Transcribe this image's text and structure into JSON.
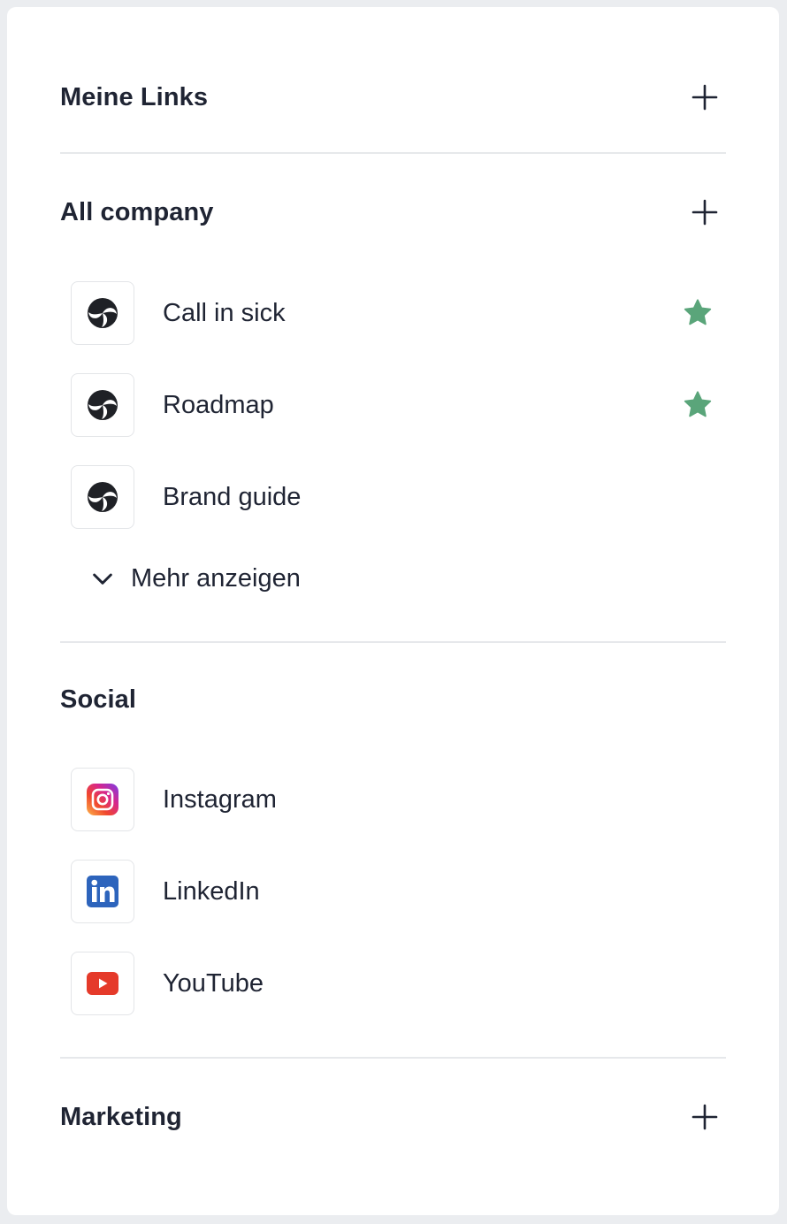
{
  "sections": {
    "my_links": {
      "title": "Meine Links",
      "add_icon": "plus-icon"
    },
    "all_company": {
      "title": "All company",
      "add_icon": "plus-icon",
      "items": [
        {
          "label": "Call in sick",
          "icon": "company-logo-icon",
          "favorite": true
        },
        {
          "label": "Roadmap",
          "icon": "company-logo-icon",
          "favorite": true
        },
        {
          "label": "Brand guide",
          "icon": "company-logo-icon",
          "favorite": false
        }
      ],
      "show_more_label": "Mehr anzeigen"
    },
    "social": {
      "title": "Social",
      "items": [
        {
          "label": "Instagram",
          "icon": "instagram-icon"
        },
        {
          "label": "LinkedIn",
          "icon": "linkedin-icon"
        },
        {
          "label": "YouTube",
          "icon": "youtube-icon"
        }
      ]
    },
    "marketing": {
      "title": "Marketing",
      "add_icon": "plus-icon"
    }
  },
  "colors": {
    "star": "#5aa57a",
    "linkedin": "#2d64bc",
    "youtube": "#e53a2a",
    "text": "#1f2433"
  }
}
